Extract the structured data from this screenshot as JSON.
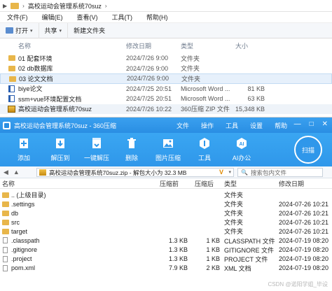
{
  "explorer": {
    "breadcrumb": "高校运动会管理系统70suz",
    "menu": [
      "文件(F)",
      "编辑(E)",
      "查看(V)",
      "工具(T)",
      "帮助(H)"
    ],
    "toolbar": {
      "open": "打开",
      "share": "共享",
      "new_folder": "新建文件夹"
    },
    "columns": {
      "name": "名称",
      "date": "修改日期",
      "type": "类型",
      "size": "大小"
    },
    "rows": [
      {
        "name": "01 配套环境",
        "date": "2024/7/26 9:00",
        "type": "文件夹",
        "size": ""
      },
      {
        "name": "02 db数据库",
        "date": "2024/7/26 9:00",
        "type": "文件夹",
        "size": ""
      },
      {
        "name": "03 论文文档",
        "date": "2024/7/26 9:00",
        "type": "文件夹",
        "size": ""
      },
      {
        "name": "biye论文",
        "date": "2024/7/25 20:51",
        "type": "Microsoft Word ...",
        "size": "81 KB"
      },
      {
        "name": "ssm+vue环境配置文档",
        "date": "2024/7/25 20:51",
        "type": "Microsoft Word ...",
        "size": "63 KB"
      },
      {
        "name": "高校运动会管理系统70suz",
        "date": "2024/7/26 10:22",
        "type": "360压缩 ZIP 文件",
        "size": "15,348 KB"
      }
    ]
  },
  "zip": {
    "title": "高校运动会管理系统70suz - 360压缩",
    "menus": [
      "文件",
      "操作",
      "工具",
      "设置",
      "帮助"
    ],
    "ribbon": [
      "添加",
      "解压到",
      "一键解压",
      "删除",
      "图片压缩",
      "工具",
      "AI办公"
    ],
    "scan": "扫描",
    "path": "高校运动会管理系统70suz.zip - 解包大小为 32.3 MB",
    "search_placeholder": "搜索包内文件",
    "columns": {
      "name": "名称",
      "zsize": "压缩前",
      "csize": "压缩后",
      "type": "类型",
      "date": "修改日期"
    },
    "rows": [
      {
        "name": ".. (上级目录)",
        "zsize": "",
        "csize": "",
        "type": "文件夹",
        "date": "",
        "kind": "up"
      },
      {
        "name": ".settings",
        "zsize": "",
        "csize": "",
        "type": "文件夹",
        "date": "2024-07-26 10:21",
        "kind": "folder"
      },
      {
        "name": "db",
        "zsize": "",
        "csize": "",
        "type": "文件夹",
        "date": "2024-07-26 10:21",
        "kind": "folder"
      },
      {
        "name": "src",
        "zsize": "",
        "csize": "",
        "type": "文件夹",
        "date": "2024-07-26 10:21",
        "kind": "folder"
      },
      {
        "name": "target",
        "zsize": "",
        "csize": "",
        "type": "文件夹",
        "date": "2024-07-26 10:21",
        "kind": "folder"
      },
      {
        "name": ".classpath",
        "zsize": "1.3 KB",
        "csize": "1 KB",
        "type": "CLASSPATH 文件",
        "date": "2024-07-19 08:20",
        "kind": "file"
      },
      {
        "name": ".gitignore",
        "zsize": "1.3 KB",
        "csize": "1 KB",
        "type": "GITIGNORE 文件",
        "date": "2024-07-19 08:20",
        "kind": "file"
      },
      {
        "name": ".project",
        "zsize": "1.3 KB",
        "csize": "1 KB",
        "type": "PROJECT 文件",
        "date": "2024-07-19 08:20",
        "kind": "file"
      },
      {
        "name": "pom.xml",
        "zsize": "7.9 KB",
        "csize": "2 KB",
        "type": "XML 文档",
        "date": "2024-07-19 08:20",
        "kind": "file"
      }
    ]
  },
  "watermark": "CSDN @诺阳学姐_毕设",
  "colors": {
    "ribbon": "#2f97ea",
    "folder": "#e8b64a",
    "selected": "#e6f0fb"
  }
}
